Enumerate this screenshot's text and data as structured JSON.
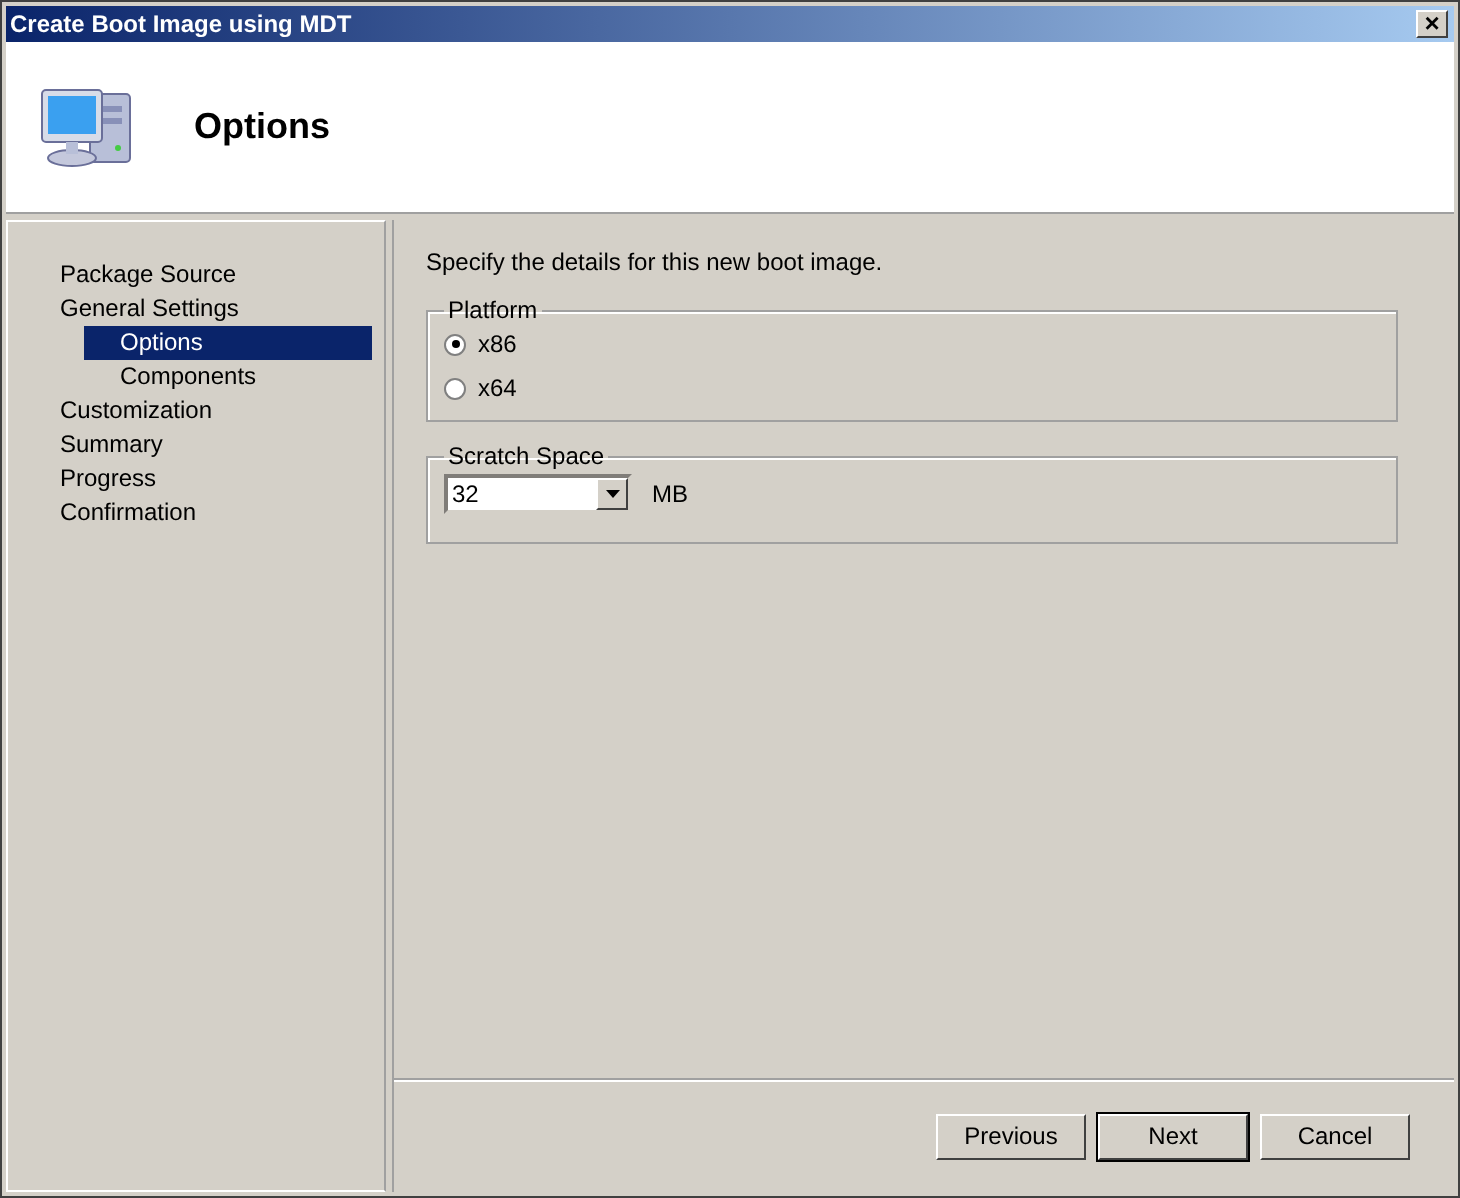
{
  "window": {
    "title": "Create Boot Image using MDT",
    "close": "×"
  },
  "header": {
    "title": "Options"
  },
  "sidebar": {
    "items": [
      {
        "label": "Package Source",
        "selected": false
      },
      {
        "label": "General Settings",
        "selected": false,
        "children": [
          {
            "label": "Options",
            "selected": true
          },
          {
            "label": "Components",
            "selected": false
          }
        ]
      },
      {
        "label": "Customization",
        "selected": false
      },
      {
        "label": "Summary",
        "selected": false
      },
      {
        "label": "Progress",
        "selected": false
      },
      {
        "label": "Confirmation",
        "selected": false
      }
    ]
  },
  "content": {
    "intro": "Specify the details for this new boot image.",
    "platform": {
      "legend": "Platform",
      "options": [
        {
          "label": "x86",
          "selected": true
        },
        {
          "label": "x64",
          "selected": false
        }
      ]
    },
    "scratch_space": {
      "legend": "Scratch Space",
      "value": "32",
      "unit": "MB"
    }
  },
  "buttons": [
    {
      "label": "Previous",
      "default": false
    },
    {
      "label": "Next",
      "default": true
    },
    {
      "label": "Cancel",
      "default": false
    }
  ]
}
